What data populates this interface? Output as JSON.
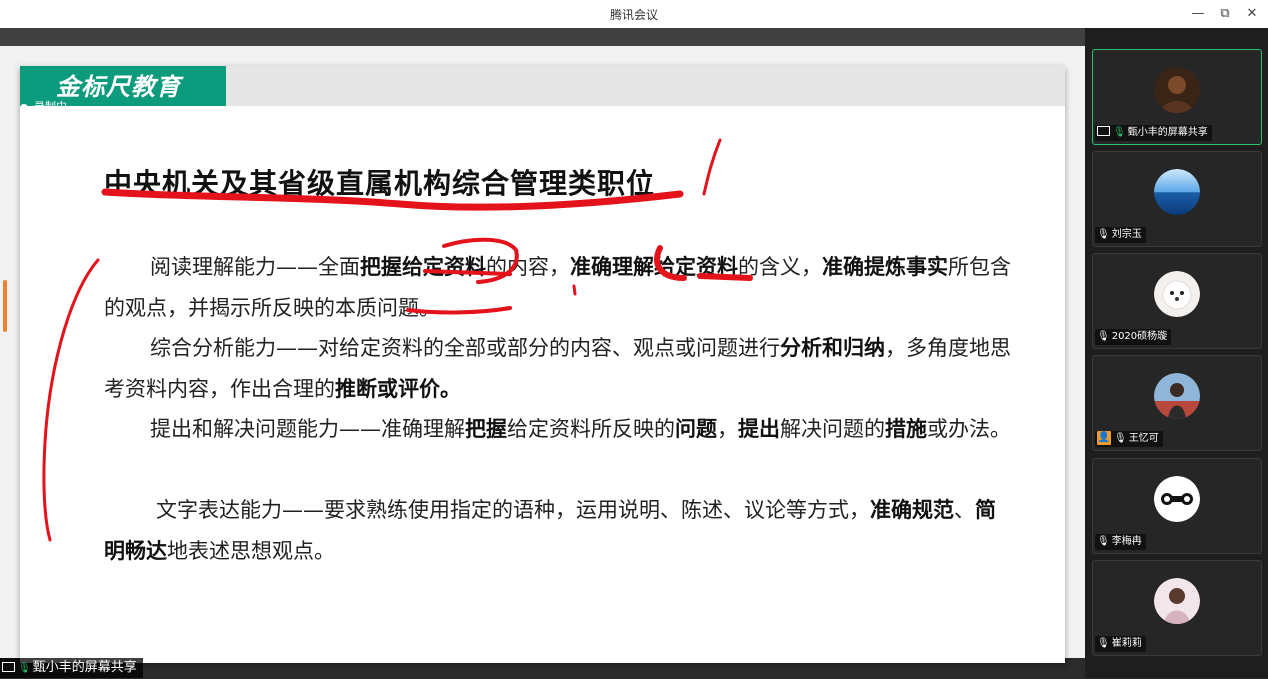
{
  "window": {
    "title": "腾讯会议",
    "minimize_label": "—",
    "restore_label": "⧉",
    "close_label": "✕"
  },
  "recording": {
    "label": "录制中"
  },
  "slide": {
    "logo_text": "金标尺教育",
    "heading": "中央机关及其省级直属机构综合管理类职位",
    "paragraphs": [
      {
        "segments": [
          {
            "t": "阅读理解能力——全面",
            "b": false
          },
          {
            "t": "把握给定资料",
            "b": true
          },
          {
            "t": "的内容，",
            "b": false
          },
          {
            "t": "准确理解给定资料",
            "b": true
          },
          {
            "t": "的含义，",
            "b": false
          },
          {
            "t": "准确提炼事实",
            "b": true
          },
          {
            "t": "所包含的观点，并揭示所反映的本质问题。",
            "b": false
          }
        ]
      },
      {
        "segments": [
          {
            "t": "综合分析能力——对给定资料的全部或部分的内容、观点或问题进行",
            "b": false
          },
          {
            "t": "分析和归纳",
            "b": true
          },
          {
            "t": "，多角度地思考资料内容，作出合理的",
            "b": false
          },
          {
            "t": "推断或评价。",
            "b": true
          }
        ]
      },
      {
        "segments": [
          {
            "t": "提出和解决问题能力——准确理解",
            "b": false
          },
          {
            "t": "把握",
            "b": true
          },
          {
            "t": "给定资料所反映的",
            "b": false
          },
          {
            "t": "问题",
            "b": true
          },
          {
            "t": "，",
            "b": false
          },
          {
            "t": "提出",
            "b": true
          },
          {
            "t": "解决问题的",
            "b": false
          },
          {
            "t": "措施",
            "b": true
          },
          {
            "t": "或办法。",
            "b": false
          }
        ]
      },
      {
        "segments": [
          {
            "t": "文字表达能力——要求熟练使用指定的语种，运用说明、陈述、议论等方式，",
            "b": false
          },
          {
            "t": "准确规范",
            "b": true
          },
          {
            "t": "、",
            "b": false
          },
          {
            "t": "简明畅达",
            "b": true
          },
          {
            "t": "地表述思想观点。",
            "b": false
          }
        ]
      }
    ]
  },
  "presenter_label": "甄小丰的屏幕共享",
  "participants": [
    {
      "name": "甄小丰的屏幕共享",
      "avatar": "dark-portrait",
      "active": true,
      "mic": "on",
      "sharing": true
    },
    {
      "name": "刘宗玉",
      "avatar": "ocean",
      "active": false,
      "mic": "muted"
    },
    {
      "name": "2020硕杨璇",
      "avatar": "puppy",
      "active": false,
      "mic": "muted"
    },
    {
      "name": "王忆可",
      "avatar": "person-outdoor",
      "active": false,
      "mic": "muted",
      "person_badge": true
    },
    {
      "name": "李梅冉",
      "avatar": "dumbbell-logo",
      "active": false,
      "mic": "muted"
    },
    {
      "name": "崔莉莉",
      "avatar": "person-portrait",
      "active": false,
      "mic": "muted"
    }
  ],
  "colors": {
    "logo_bg": "#0d9b7e",
    "annotation": "#e3121b",
    "active_border": "#27c36b",
    "scroll_marker": "#f07f2e"
  }
}
